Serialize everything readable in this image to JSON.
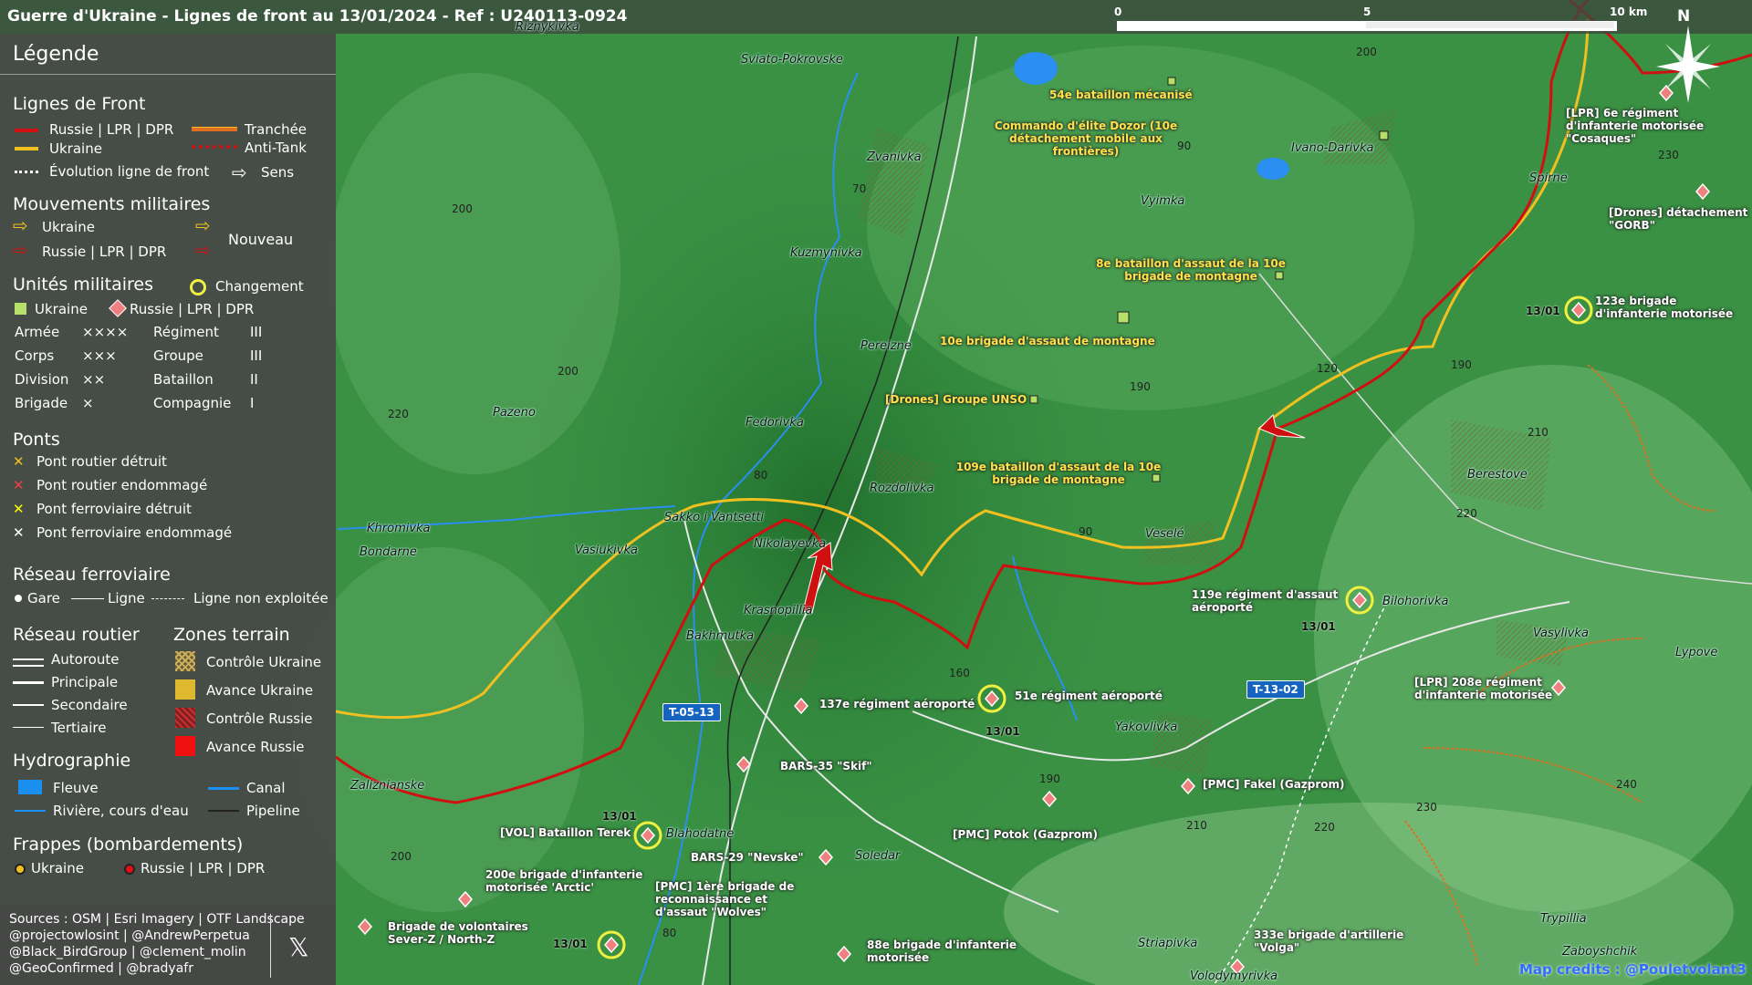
{
  "title": "Guerre d'Ukraine - Lignes de front au 13/01/2024 - Ref : U240113-0924",
  "legend": {
    "heading": "Légende",
    "front": {
      "heading": "Lignes de Front",
      "ru": "Russie | LPR | DPR",
      "ua": "Ukraine",
      "evo": "Évolution ligne de front",
      "trench": "Tranchée",
      "anti": "Anti-Tank",
      "sens": "Sens"
    },
    "moves": {
      "heading": "Mouvements militaires",
      "ua": "Ukraine",
      "ru": "Russie | LPR | DPR",
      "new": "Nouveau"
    },
    "units": {
      "heading": "Unités militaires",
      "change": "Changement",
      "ua": "Ukraine",
      "ru": "Russie | LPR | DPR",
      "rows": [
        [
          "Armée",
          "××××",
          "Régiment",
          "III"
        ],
        [
          "Corps",
          "×××",
          "Groupe",
          "III"
        ],
        [
          "Division",
          "××",
          "Bataillon",
          "II"
        ],
        [
          "Brigade",
          "×",
          "Compagnie",
          "I"
        ]
      ]
    },
    "bridges": {
      "heading": "Ponts",
      "items": [
        "Pont routier détruit",
        "Pont routier endommagé",
        "Pont ferroviaire détruit",
        "Pont ferroviaire endommagé"
      ]
    },
    "rail": {
      "heading": "Réseau ferroviaire",
      "gare": "Gare",
      "ligne": "Ligne",
      "non": "Ligne non exploitée"
    },
    "roads": {
      "heading": "Réseau routier",
      "items": [
        "Autoroute",
        "Principale",
        "Secondaire",
        "Tertiaire"
      ]
    },
    "zones": {
      "heading": "Zones terrain",
      "items": [
        "Contrôle Ukraine",
        "Avance Ukraine",
        "Contrôle Russie",
        "Avance Russie"
      ]
    },
    "hydro": {
      "heading": "Hydrographie",
      "fleuve": "Fleuve",
      "riviere": "Rivière, cours d'eau",
      "canal": "Canal",
      "pipeline": "Pipeline"
    },
    "strikes": {
      "heading": "Frappes (bombardements)",
      "ua": "Ukraine",
      "ru": "Russie | LPR | DPR"
    }
  },
  "sources": [
    "Sources : OSM | Esri Imagery | OTF Landscape",
    "@projectowlosint | @AndrewPerpetua",
    "@Black_BirdGroup | @clement_molin",
    "@GeoConfirmed | @bradyafr"
  ],
  "x_logo": "𝕏",
  "scale": {
    "l0": "0",
    "l5": "5",
    "l10": "10 km"
  },
  "compass": "N",
  "credit": "Map credits : @Pouletvolant3",
  "towns": [
    "Riznykivka",
    "Sviato-Pokrovske",
    "Zvanivka",
    "Ivano-Darivka",
    "Vyimka",
    "Kuzmynivka",
    "Spirne",
    "Pereizne",
    "Pazeno",
    "Fedorivka",
    "Rozdolivka",
    "Sakko i Vantsetti",
    "Khromivka",
    "Bondarne",
    "Vasiukivka",
    "Nikolayevka",
    "Krasnopillia",
    "Veselé",
    "Berestove",
    "Bilohorivka",
    "Vasylivka",
    "Lypove",
    "Zaliznianske",
    "Blahodatne",
    "Soledar",
    "Yakovlivka",
    "Striapivka",
    "Volodymyrivka",
    "Trypillia",
    "Zaboyshchik",
    "Bakhmutka"
  ],
  "units_ua": [
    "54e bataillon mécanisé",
    "Commando d'élite Dozor (10e détachement mobile aux frontières)",
    "8e bataillon d'assaut de la 10e brigade de montagne",
    "10e brigade d'assaut de montagne",
    "[Drones] Groupe UNSO",
    "109e bataillon d'assaut de la 10e brigade de montagne"
  ],
  "units_ru": [
    "[LPR] 6e régiment d'infanterie motorisée \"Cosaques\"",
    "[Drones] détachement \"GORB\"",
    "123e brigade d'infanterie motorisée",
    "119e régiment d'assaut aéroporté",
    "[LPR] 208e régiment d'infanterie motorisée",
    "137e régiment aéroporté",
    "51e régiment aéroporté",
    "BARS-35 \"Skif\"",
    "[PMC] Fakel (Gazprom)",
    "[PMC] Potok (Gazprom)",
    "[VOL] Bataillon Terek",
    "BARS-29 \"Nevske\"",
    "200e brigade d'infanterie motorisée 'Arctic'",
    "[PMC] 1ère brigade de reconnaissance et d'assaut \"Wolves\"",
    "Brigade de volontaires Sever-Z / North-Z",
    "88e brigade d'infanterie motorisée",
    "333e brigade d'artillerie \"Volga\""
  ],
  "dates": [
    "13/01",
    "13/01",
    "13/01",
    "13/01",
    "13/01"
  ],
  "elevations": [
    "200",
    "90",
    "230",
    "200",
    "200",
    "120",
    "190",
    "210",
    "220",
    "190",
    "80",
    "220",
    "90",
    "160",
    "190",
    "210",
    "220",
    "230",
    "240",
    "200",
    "70",
    "80"
  ],
  "roads": [
    "T-05-13",
    "T-13-02"
  ],
  "colors": {
    "ru": "#d01010",
    "ua": "#f0c020",
    "legend_bg": "#464846"
  }
}
